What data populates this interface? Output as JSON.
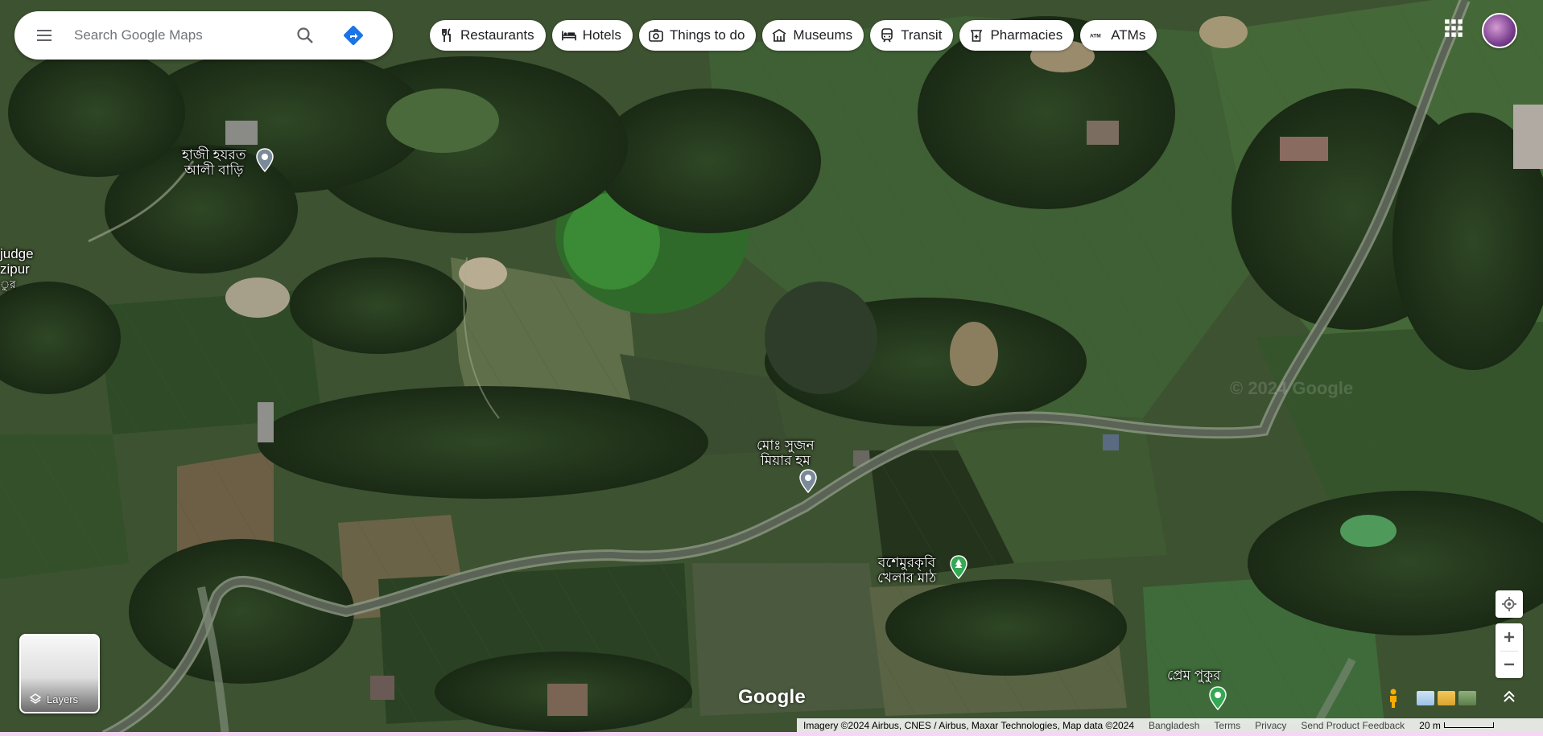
{
  "search": {
    "placeholder": "Search Google Maps"
  },
  "chips": [
    {
      "label": "Restaurants",
      "icon": "fork-knife-icon"
    },
    {
      "label": "Hotels",
      "icon": "bed-icon"
    },
    {
      "label": "Things to do",
      "icon": "camera-icon"
    },
    {
      "label": "Museums",
      "icon": "museum-icon"
    },
    {
      "label": "Transit",
      "icon": "train-icon"
    },
    {
      "label": "Pharmacies",
      "icon": "pharmacy-icon"
    },
    {
      "label": "ATMs",
      "icon": "atm-icon"
    }
  ],
  "places": {
    "haji": {
      "line1": "হাজী হযরত",
      "line2": "আলী বাড়ি"
    },
    "sujon": {
      "line1": "মোঃ সুজন",
      "line2": "মিয়ার হম"
    },
    "field": {
      "line1": "বশেমুরকৃবি",
      "line2": "খেলার মাঠ"
    },
    "prem": {
      "line1": "প্রেম পুকুর"
    },
    "edge": {
      "line1": "judge",
      "line2": "zipur",
      "line3": "ুর"
    }
  },
  "watermark": "© 2024 Google",
  "layers": {
    "label": "Layers"
  },
  "google_logo": "Google",
  "footer": {
    "attribution": "Imagery ©2024 Airbus, CNES / Airbus, Maxar Technologies, Map data ©2024",
    "country": "Bangladesh",
    "terms": "Terms",
    "privacy": "Privacy",
    "feedback": "Send Product Feedback",
    "scale": "20 m"
  },
  "colors": {
    "accent_blue": "#1a73e8",
    "pin_gray": "#7b8a99",
    "park_green": "#34a853"
  }
}
